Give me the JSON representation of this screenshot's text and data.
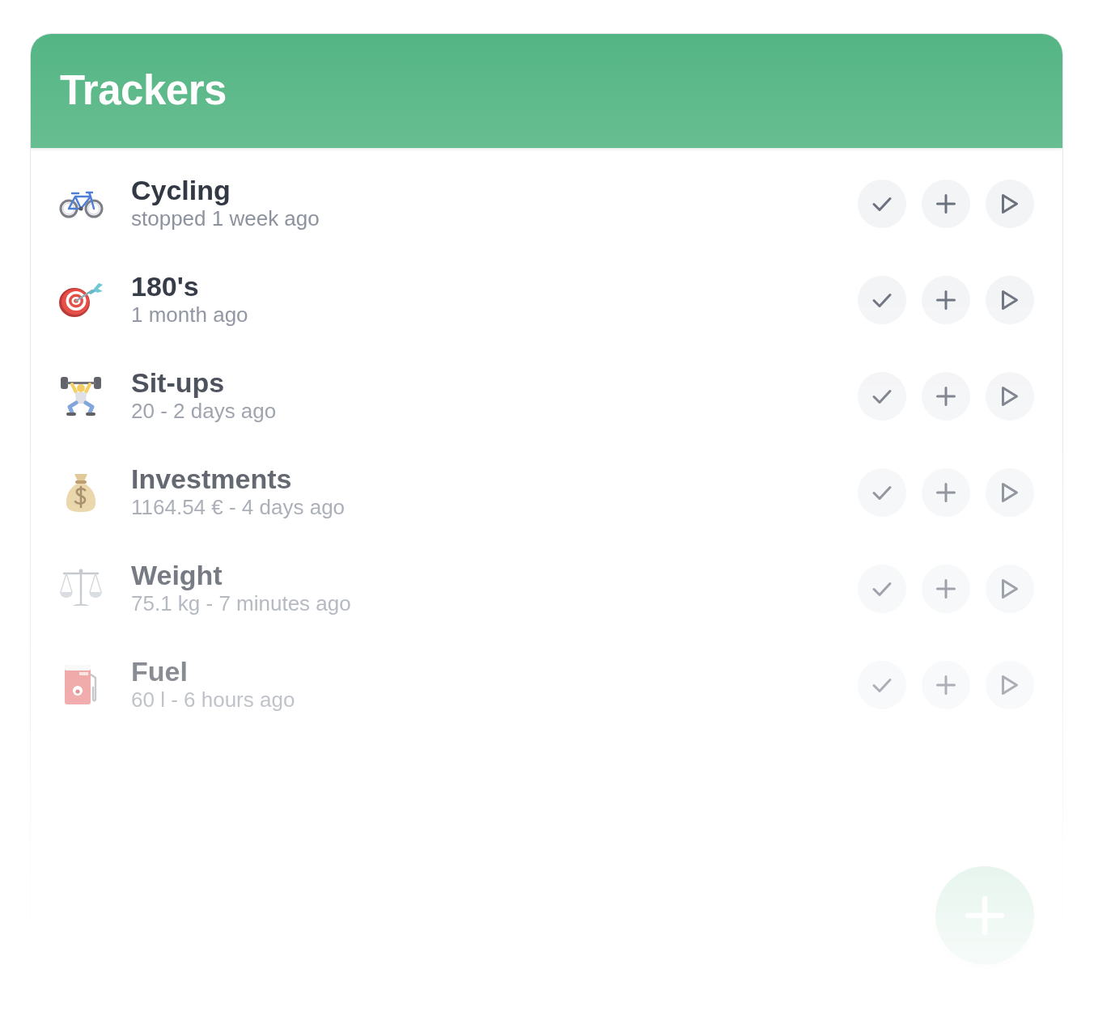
{
  "header": {
    "title": "Trackers"
  },
  "trackers": [
    {
      "name": "Cycling",
      "detail": "stopped 1 week ago"
    },
    {
      "name": "180's",
      "detail": "1 month ago"
    },
    {
      "name": "Sit-ups",
      "detail": "20 - 2 days ago"
    },
    {
      "name": "Investments",
      "detail": "1164.54 € - 4 days ago"
    },
    {
      "name": "Weight",
      "detail": "75.1 kg - 7 minutes ago"
    },
    {
      "name": "Fuel",
      "detail": "60 l - 6 hours ago"
    }
  ]
}
